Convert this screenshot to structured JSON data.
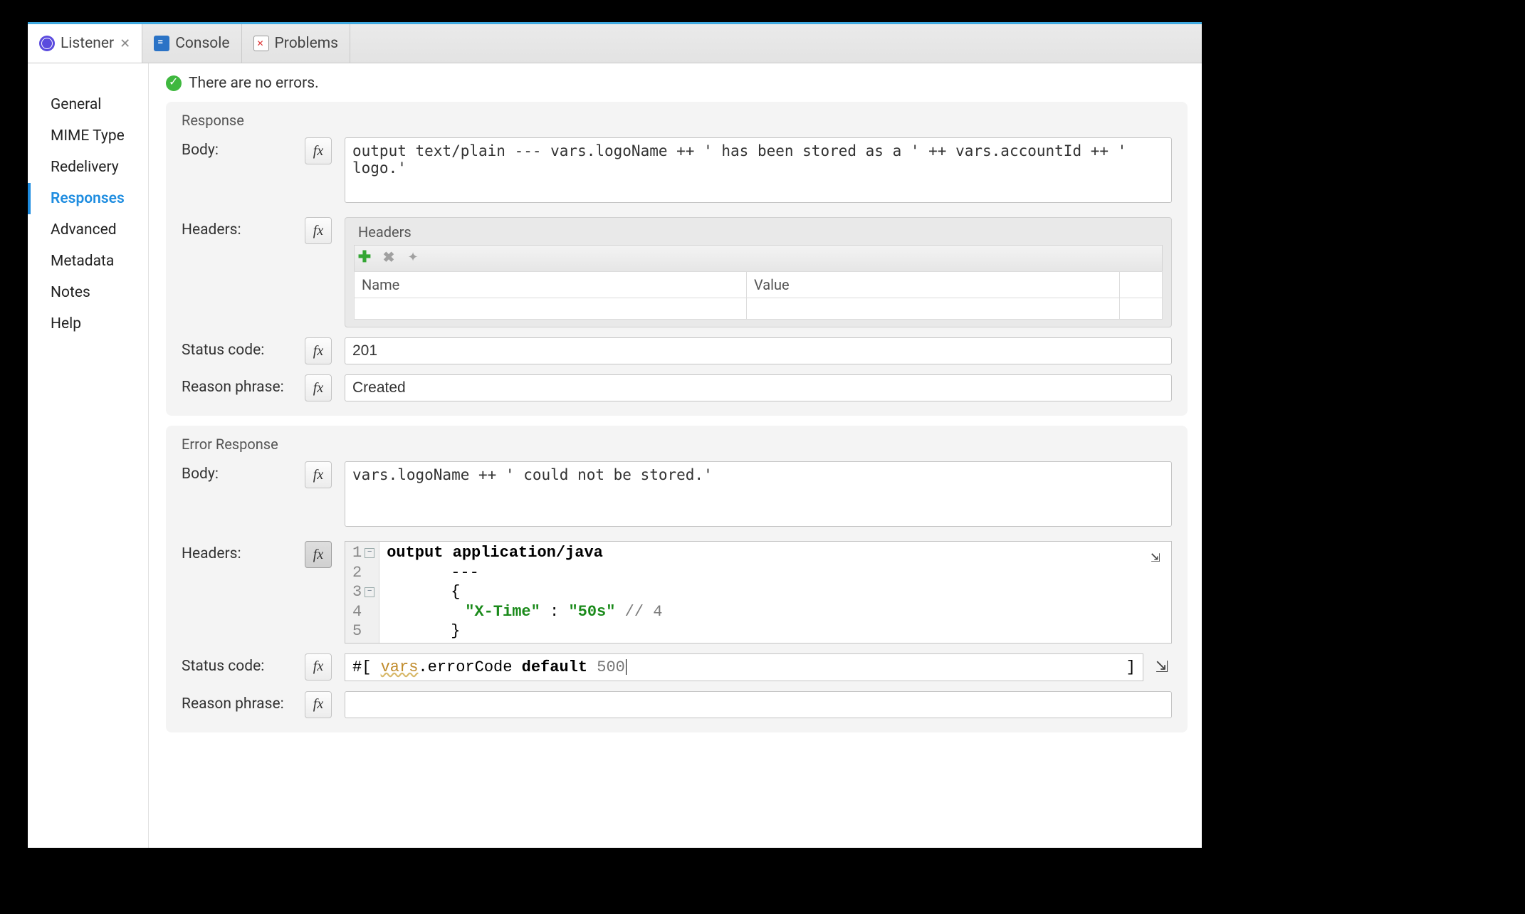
{
  "tabs": {
    "listener": "Listener",
    "console": "Console",
    "problems": "Problems"
  },
  "sidebar": {
    "items": [
      "General",
      "MIME Type",
      "Redelivery",
      "Responses",
      "Advanced",
      "Metadata",
      "Notes",
      "Help"
    ],
    "activeIndex": 3
  },
  "status": {
    "message": "There are no errors."
  },
  "response": {
    "title": "Response",
    "body_label": "Body:",
    "body_value": "output text/plain --- vars.logoName ++ ' has been stored as a ' ++ vars.accountId ++ ' logo.'",
    "headers_label": "Headers:",
    "headers_panel_title": "Headers",
    "headers_table": {
      "col_name": "Name",
      "col_value": "Value"
    },
    "status_code_label": "Status code:",
    "status_code_value": "201",
    "reason_label": "Reason phrase:",
    "reason_value": "Created"
  },
  "error_response": {
    "title": "Error Response",
    "body_label": "Body:",
    "body_value": "vars.logoName ++ ' could not be stored.'",
    "headers_label": "Headers:",
    "headers_code": {
      "lines": [
        {
          "n": "1",
          "fold": "-",
          "tokens": [
            {
              "t": "kw",
              "v": "output application/java"
            }
          ]
        },
        {
          "n": "2",
          "fold": "",
          "tokens": [
            {
              "t": "punct",
              "v": "---"
            }
          ]
        },
        {
          "n": "3",
          "fold": "-",
          "tokens": [
            {
              "t": "punct",
              "v": "{"
            }
          ]
        },
        {
          "n": "4",
          "fold": "",
          "tokens": [
            {
              "t": "str",
              "v": "\"X-Time\""
            },
            {
              "t": "punct",
              "v": " : "
            },
            {
              "t": "str",
              "v": "\"50s\" "
            },
            {
              "t": "cmt",
              "v": "// 4"
            }
          ]
        },
        {
          "n": "5",
          "fold": "",
          "tokens": [
            {
              "t": "punct",
              "v": "}"
            }
          ]
        }
      ]
    },
    "status_code_label": "Status code:",
    "status_code_expr": {
      "prefix": "#[ ",
      "var": "vars",
      "dot_errorCode": ".errorCode ",
      "kw": "default ",
      "num": "500",
      "suffix": " ]"
    },
    "reason_label": "Reason phrase:",
    "reason_value": ""
  },
  "fx_label": "fx"
}
